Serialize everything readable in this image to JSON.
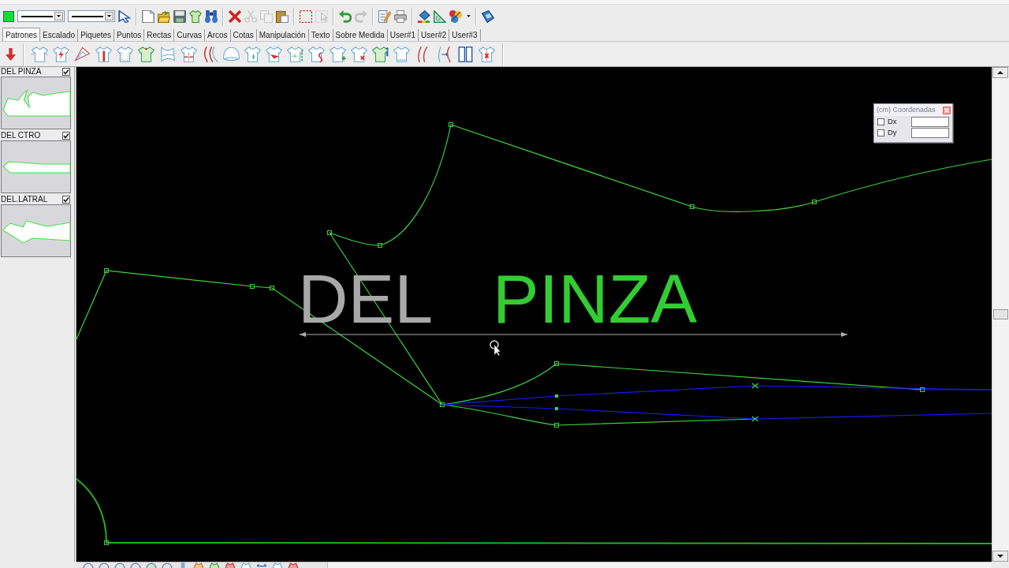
{
  "toolbar": [
    {
      "disabled": false
    },
    {
      "disabled": false
    },
    {
      "disabled": false
    },
    {
      "disabled": false
    },
    {
      "disabled": false
    },
    {
      "disabled": false
    },
    {
      "disabled": false
    },
    {
      "disabled": true
    },
    {
      "disabled": true
    },
    {
      "disabled": false
    },
    {
      "disabled": false
    },
    {
      "disabled": true
    },
    {
      "disabled": false
    },
    {
      "disabled": true
    },
    {
      "disabled": false
    },
    {
      "disabled": false
    },
    {
      "disabled": false
    },
    {
      "disabled": false
    },
    {
      "disabled": false
    },
    {
      "disabled": false
    }
  ],
  "tabs": [
    {
      "label": "Patrones",
      "selected": true
    },
    {
      "label": "Escalado",
      "selected": false
    },
    {
      "label": "Piquetes",
      "selected": false
    },
    {
      "label": "Puntos",
      "selected": false
    },
    {
      "label": "Rectas",
      "selected": false
    },
    {
      "label": "Curvas",
      "selected": false
    },
    {
      "label": "Arcos",
      "selected": false
    },
    {
      "label": "Cotas",
      "selected": false
    },
    {
      "label": "Manipulación",
      "selected": false
    },
    {
      "label": "Texto",
      "selected": false
    },
    {
      "label": "Sobre Medida",
      "selected": false
    },
    {
      "label": "User#1",
      "selected": false
    },
    {
      "label": "User#2",
      "selected": false
    },
    {
      "label": "User#3",
      "selected": false
    }
  ],
  "pieces": [
    {
      "name": "DEL PINZA",
      "checked": true
    },
    {
      "name": "DEL CTRO",
      "checked": true
    },
    {
      "name": "DEL.LATRAL",
      "checked": true
    }
  ],
  "canvas": {
    "labels": [
      {
        "text": "DEL",
        "color": "#a8a8a8"
      },
      {
        "text": "PINZA",
        "color": "#33cc33"
      }
    ]
  },
  "coordinates_panel": {
    "title": "(cm) Coordenadas",
    "rows": [
      {
        "label": "Dx",
        "checked": false
      },
      {
        "label": "Dy",
        "checked": false
      }
    ]
  }
}
